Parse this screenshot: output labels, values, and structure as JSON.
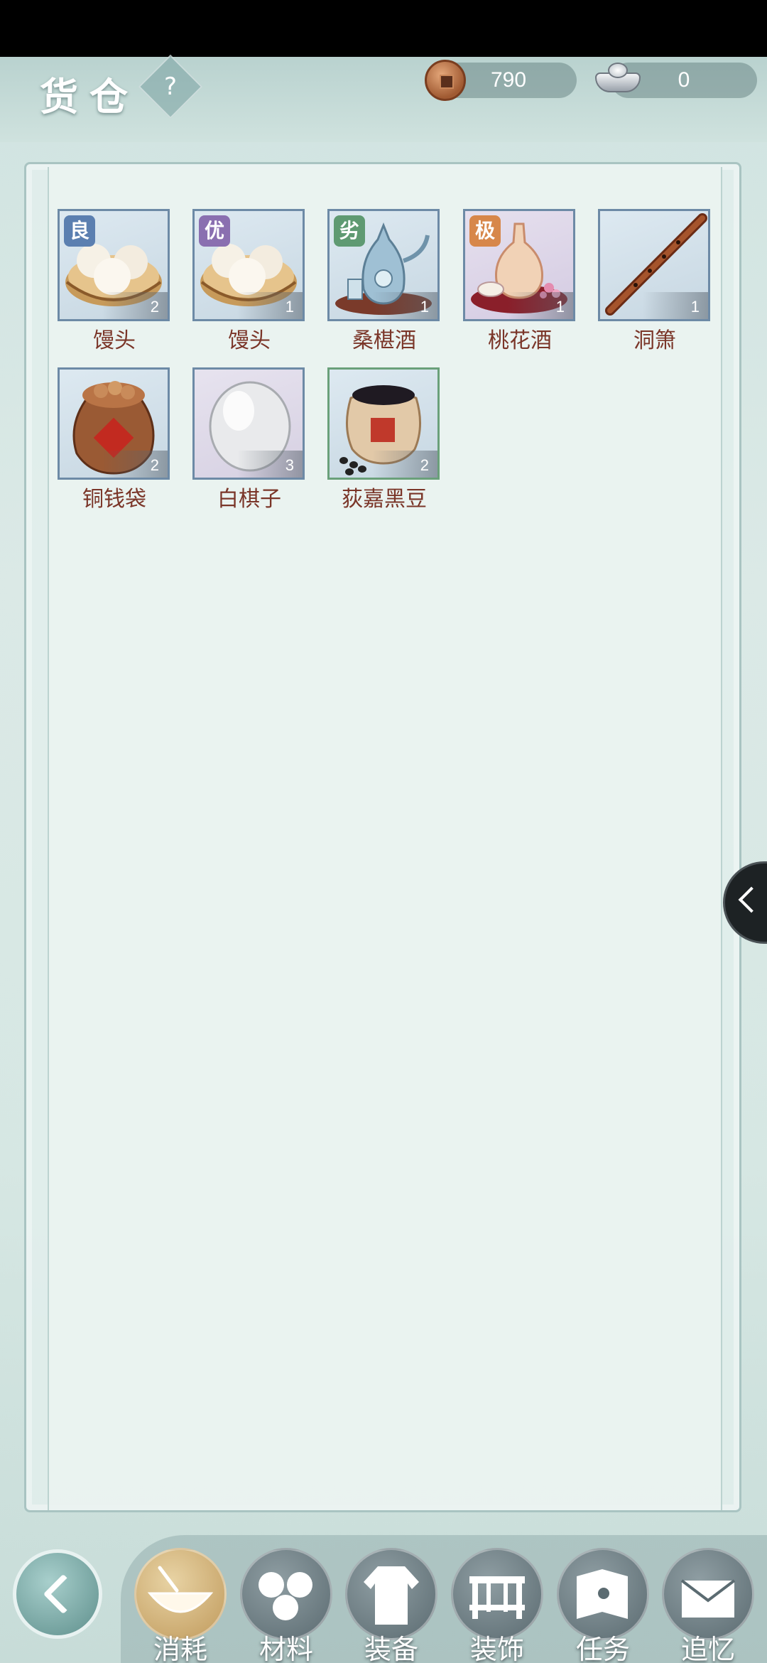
{
  "header": {
    "title": "货仓",
    "help_label": "?",
    "copper": "790",
    "silver": "0"
  },
  "items": [
    {
      "name": "馒头",
      "count": "2",
      "grade": "良",
      "grade_color": "#5b7fb0"
    },
    {
      "name": "馒头",
      "count": "1",
      "grade": "优",
      "grade_color": "#8a6fb0"
    },
    {
      "name": "桑椹酒",
      "count": "1",
      "grade": "劣",
      "grade_color": "#5f9a72"
    },
    {
      "name": "桃花酒",
      "count": "1",
      "grade": "极",
      "grade_color": "#d7874a"
    },
    {
      "name": "洞箫",
      "count": "1"
    },
    {
      "name": "铜钱袋",
      "count": "2"
    },
    {
      "name": "白棋子",
      "count": "3"
    },
    {
      "name": "荻嘉黑豆",
      "count": "2"
    }
  ],
  "tabs": [
    {
      "label": "消耗",
      "active": true
    },
    {
      "label": "材料"
    },
    {
      "label": "装备"
    },
    {
      "label": "装饰"
    },
    {
      "label": "任务"
    },
    {
      "label": "追忆"
    }
  ]
}
